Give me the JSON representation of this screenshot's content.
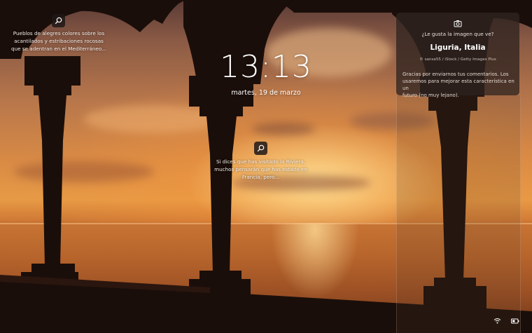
{
  "lockscreen": {
    "time": "13:13",
    "date": "martes, 19 de marzo"
  },
  "spotlight_top_left": {
    "text_line1": "Pueblos de alegres colores sobre los",
    "text_line2": "acantilados y estribaciones rocosas",
    "text_line3": "que se adentran en el Mediterráneo..."
  },
  "spotlight_center": {
    "text_line1": "Si dices que has visitado la Riviera,",
    "text_line2": "muchos pensarán que has estado en",
    "text_line3": "Francia, pero..."
  },
  "feedback_panel": {
    "question": "¿Le gusta la imagen que ve?",
    "location": "Liguria, Italia",
    "credit": "© sansa55 / iStock / Getty Images Plus",
    "message_line1": "Gracias por enviarnos tus comentarios. Los",
    "message_line2": "usaremos para mejorar esta característica en un",
    "message_line3": "futuro (no muy lejano)."
  },
  "icons": {
    "search": "search-icon",
    "camera": "camera-icon",
    "network": "wifi-icon",
    "battery": "battery-icon"
  },
  "colors": {
    "panel_bg": "#302420",
    "icon_bg": "#1e1816",
    "text": "#ffffff"
  }
}
